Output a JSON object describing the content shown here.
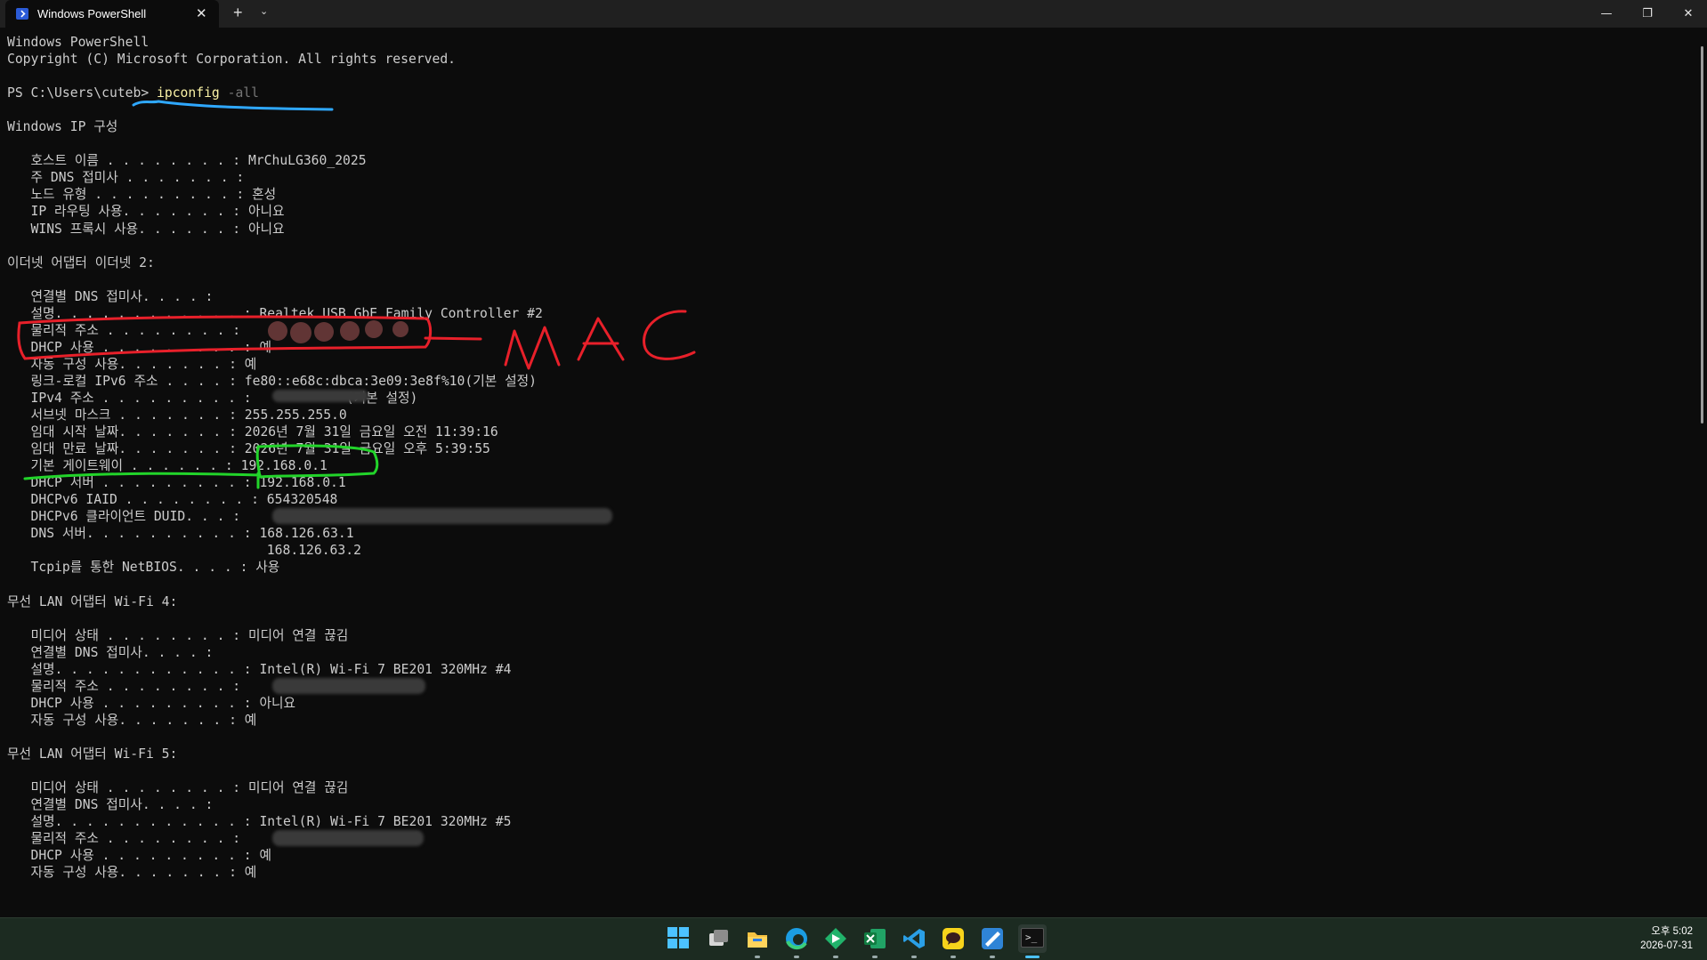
{
  "window": {
    "tab_title": "Windows PowerShell",
    "tab_close": "✕",
    "new_tab": "+",
    "tab_dropdown": "⌄",
    "minimize": "—",
    "maximize": "❐",
    "close": "✕"
  },
  "terminal": {
    "lines": [
      {
        "text": "Windows PowerShell"
      },
      {
        "text": "Copyright (C) Microsoft Corporation. All rights reserved."
      },
      {
        "text": ""
      },
      {
        "prompt": "PS C:\\Users\\cuteb> ",
        "command": "ipconfig",
        "arg": " -all"
      },
      {
        "text": ""
      },
      {
        "text": "Windows IP 구성"
      },
      {
        "text": ""
      },
      {
        "text": "   호스트 이름 . . . . . . . . : MrChuLG360_2025"
      },
      {
        "text": "   주 DNS 접미사 . . . . . . . :"
      },
      {
        "text": "   노드 유형 . . . . . . . . . : 혼성"
      },
      {
        "text": "   IP 라우팅 사용. . . . . . . : 아니요"
      },
      {
        "text": "   WINS 프록시 사용. . . . . . : 아니요"
      },
      {
        "text": ""
      },
      {
        "text": "이더넷 어댑터 이더넷 2:"
      },
      {
        "text": ""
      },
      {
        "text": "   연결별 DNS 접미사. . . . :"
      },
      {
        "text": "   설명. . . . . . . . . . . . : Realtek USB GbE Family Controller #2"
      },
      {
        "text": "   물리적 주소 . . . . . . . . : "
      },
      {
        "text": "   DHCP 사용 . . . . . . . . . : 예"
      },
      {
        "text": "   자동 구성 사용. . . . . . . : 예"
      },
      {
        "text": "   링크-로컬 IPv6 주소 . . . . : fe80::e68c:dbca:3e09:3e8f%10(기본 설정)"
      },
      {
        "text": "   IPv4 주소 . . . . . . . . . :            (기본 설정)"
      },
      {
        "text": "   서브넷 마스크 . . . . . . . : 255.255.255.0"
      },
      {
        "text": "   임대 시작 날짜. . . . . . . : 2026년 7월 31일 금요일 오전 11:39:16"
      },
      {
        "text": "   임대 만료 날짜. . . . . . . : 2026년 7월 31일 금요일 오후 5:39:55"
      },
      {
        "text": "   기본 게이트웨이 . . . . . . : 192.168.0.1"
      },
      {
        "text": "   DHCP 서버 . . . . . . . . . : 192.168.0.1"
      },
      {
        "text": "   DHCPv6 IAID . . . . . . . . : 654320548"
      },
      {
        "text": "   DHCPv6 클라이언트 DUID. . . : "
      },
      {
        "text": "   DNS 서버. . . . . . . . . . : 168.126.63.1"
      },
      {
        "text": "                                 168.126.63.2"
      },
      {
        "text": "   Tcpip를 통한 NetBIOS. . . . : 사용"
      },
      {
        "text": ""
      },
      {
        "text": "무선 LAN 어댑터 Wi-Fi 4:"
      },
      {
        "text": ""
      },
      {
        "text": "   미디어 상태 . . . . . . . . : 미디어 연결 끊김"
      },
      {
        "text": "   연결별 DNS 접미사. . . . :"
      },
      {
        "text": "   설명. . . . . . . . . . . . : Intel(R) Wi-Fi 7 BE201 320MHz #4"
      },
      {
        "text": "   물리적 주소 . . . . . . . . : "
      },
      {
        "text": "   DHCP 사용 . . . . . . . . . : 아니요"
      },
      {
        "text": "   자동 구성 사용. . . . . . . : 예"
      },
      {
        "text": ""
      },
      {
        "text": "무선 LAN 어댑터 Wi-Fi 5:"
      },
      {
        "text": ""
      },
      {
        "text": "   미디어 상태 . . . . . . . . : 미디어 연결 끊김"
      },
      {
        "text": "   연결별 DNS 접미사. . . . :"
      },
      {
        "text": "   설명. . . . . . . . . . . . : Intel(R) Wi-Fi 7 BE201 320MHz #5"
      },
      {
        "text": "   물리적 주소 . . . . . . . . : "
      },
      {
        "text": "   DHCP 사용 . . . . . . . . . : 예"
      },
      {
        "text": "   자동 구성 사용. . . . . . . : 예"
      }
    ]
  },
  "annotations": {
    "mac_label": "MAC"
  },
  "taskbar": {
    "icons": [
      "windows-start-icon",
      "task-view-icon",
      "file-explorer-icon",
      "edge-icon",
      "green-app-icon",
      "excel-icon",
      "vscode-icon",
      "kakaotalk-icon",
      "blue-app-icon",
      "terminal-icon"
    ],
    "clock_time": "오후 5:02",
    "clock_date": "2026-07-31"
  },
  "colors": {
    "background": "#0c0c0c",
    "text": "#cccccc",
    "command": "#f9f1a5",
    "red_annotation": "#e8202a",
    "green_annotation": "#22d42a",
    "blue_annotation": "#2fa8ff"
  }
}
